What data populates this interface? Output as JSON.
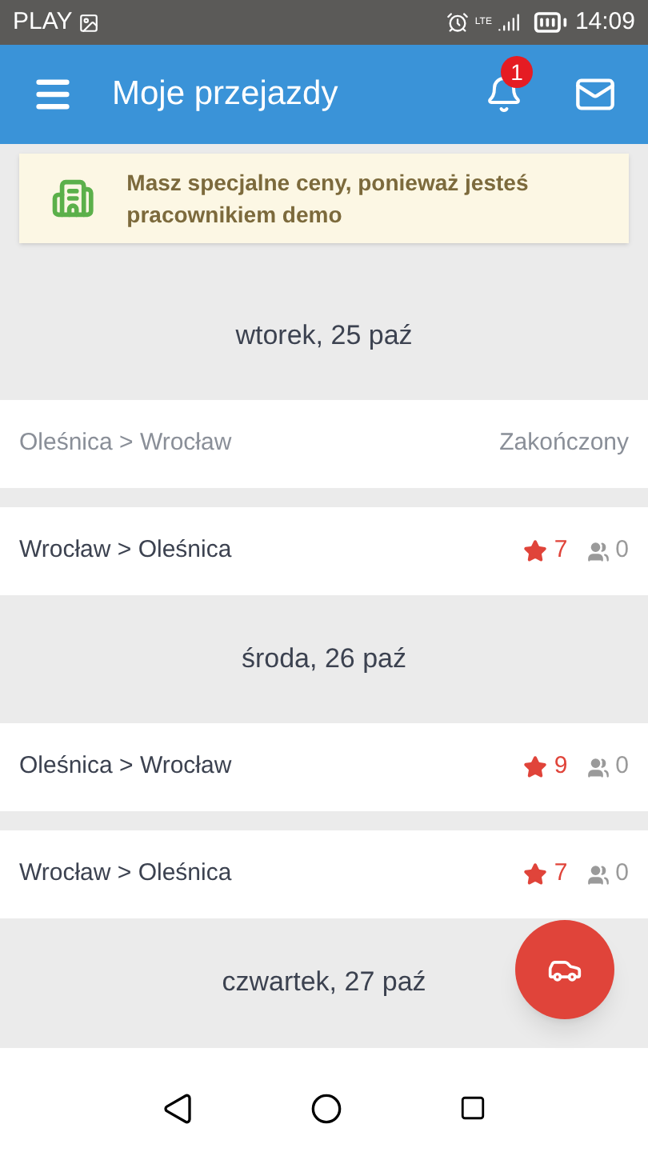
{
  "status_bar": {
    "carrier": "PLAY",
    "network": "LTE",
    "time": "14:09"
  },
  "app_bar": {
    "title": "Moje przejazdy",
    "notification_count": "1"
  },
  "banner": {
    "text": "Masz specjalne ceny, ponieważ jesteś pracownikiem demo"
  },
  "items": [
    {
      "kind": "date",
      "label": "wtorek, 25 paź"
    },
    {
      "kind": "ride",
      "route": "Oleśnica > Wrocław",
      "finished": true,
      "status": "Zakończony"
    },
    {
      "kind": "ride",
      "route": "Wrocław > Oleśnica",
      "finished": false,
      "rating": "7",
      "passengers": "0"
    },
    {
      "kind": "date",
      "label": "środa, 26 paź"
    },
    {
      "kind": "ride",
      "route": "Oleśnica > Wrocław",
      "finished": false,
      "rating": "9",
      "passengers": "0"
    },
    {
      "kind": "ride",
      "route": "Wrocław > Oleśnica",
      "finished": false,
      "rating": "7",
      "passengers": "0"
    },
    {
      "kind": "date",
      "label": "czwartek, 27 paź"
    }
  ]
}
